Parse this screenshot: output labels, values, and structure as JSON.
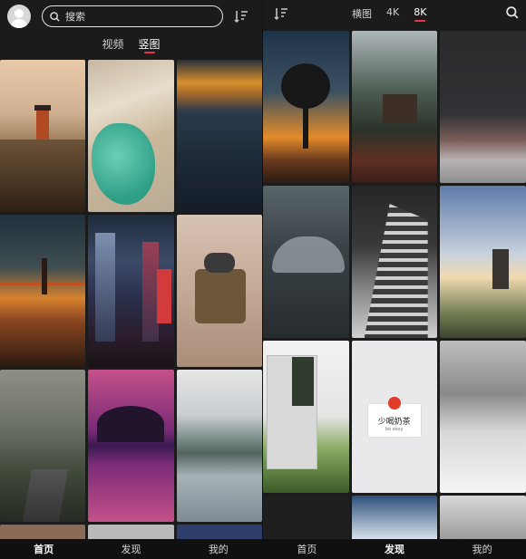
{
  "left": {
    "search": {
      "placeholder": "搜索"
    },
    "tabs": [
      {
        "label": "视频",
        "active": false
      },
      {
        "label": "竖图",
        "active": true
      }
    ],
    "nav": [
      {
        "label": "首页",
        "active": true
      },
      {
        "label": "发现",
        "active": false
      },
      {
        "label": "我的",
        "active": false
      }
    ]
  },
  "right": {
    "tabs": [
      {
        "label": "横图",
        "active": false
      },
      {
        "label": "4K",
        "active": false
      },
      {
        "label": "8K",
        "active": true
      }
    ],
    "nav": [
      {
        "label": "首页",
        "active": false
      },
      {
        "label": "发现",
        "active": true
      },
      {
        "label": "我的",
        "active": false
      }
    ],
    "poster": {
      "text": "少喝奶茶",
      "sub": "be easy"
    }
  },
  "colors": {
    "accent": "#e8344a",
    "bg": "#1b1b1b"
  },
  "icons": [
    "user-avatar",
    "search-icon",
    "sort-icon"
  ]
}
